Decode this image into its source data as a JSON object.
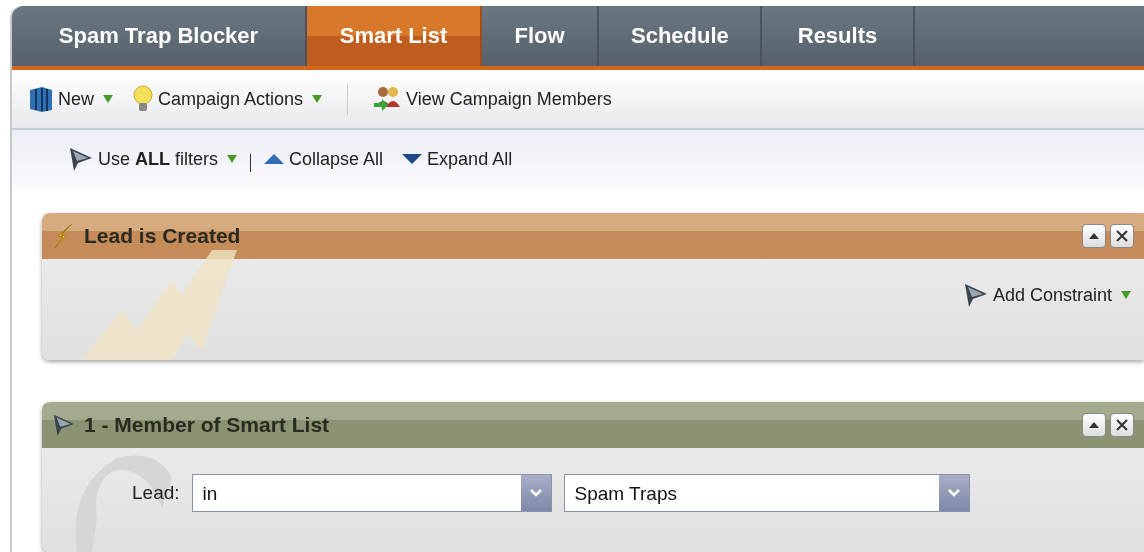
{
  "tabs": [
    {
      "label": "Spam Trap Blocker",
      "selected": false
    },
    {
      "label": "Smart List",
      "selected": true
    },
    {
      "label": "Flow",
      "selected": false
    },
    {
      "label": "Schedule",
      "selected": false
    },
    {
      "label": "Results",
      "selected": false
    }
  ],
  "toolbar": {
    "new": "New",
    "campaign_actions": "Campaign Actions",
    "view_members": "View Campaign Members"
  },
  "filter_bar": {
    "mode": "Use **ALL** filters",
    "collapse_all": "Collapse All",
    "expand_all": "Expand All"
  },
  "panels": [
    {
      "kind": "trigger",
      "title": "Lead is Created",
      "add_constraint": "Add Constraint"
    },
    {
      "kind": "filter",
      "title": "1 - Member of Smart List",
      "field_label": "Lead:",
      "operator": "in",
      "value": "Spam Traps"
    }
  ]
}
